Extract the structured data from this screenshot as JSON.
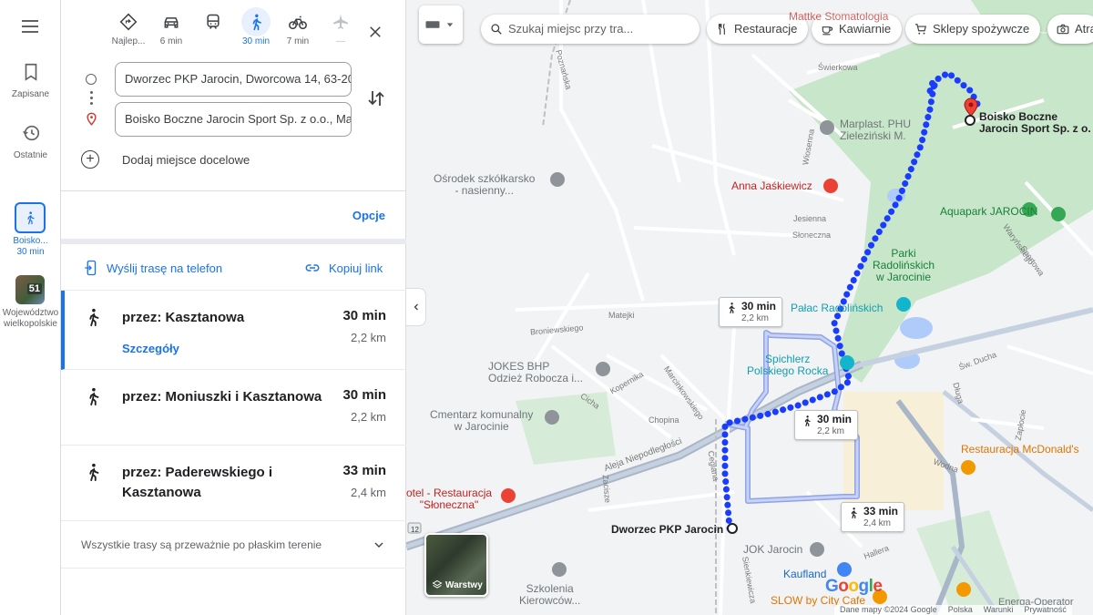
{
  "rail": {
    "saved_label": "Zapisane",
    "recent_label": "Ostatnie",
    "trip_label": "Boisko...",
    "trip_time": "30 min",
    "thumb_badge": "51",
    "thumb_label_1": "Województwo",
    "thumb_label_2": "wielkopolskie"
  },
  "modes": [
    {
      "name": "best",
      "label": "Najlep..."
    },
    {
      "name": "car",
      "label": "6 min"
    },
    {
      "name": "transit",
      "label": ""
    },
    {
      "name": "walk",
      "label": "30 min"
    },
    {
      "name": "bike",
      "label": "7 min"
    },
    {
      "name": "flight",
      "label": "—"
    }
  ],
  "waypoints": {
    "origin": "Dworzec PKP Jarocin, Dworcowa 14, 63-200",
    "destination": "Boisko Boczne Jarocin Sport Sp. z o.o., Ma",
    "add_label": "Dodaj miejsce docelowe"
  },
  "options_label": "Opcje",
  "share": {
    "send_label": "Wyślij trasę na telefon",
    "copy_label": "Kopiuj link"
  },
  "routes": [
    {
      "title": "przez: Kasztanowa",
      "time": "30 min",
      "distance": "2,2 km",
      "details": "Szczegóły"
    },
    {
      "title": "przez: Moniuszki i Kasztanowa",
      "time": "30 min",
      "distance": "2,2 km"
    },
    {
      "title": "przez: Paderewskiego i Kasztanowa",
      "time": "33 min",
      "distance": "2,4 km"
    }
  ],
  "flat_terrain_note": "Wszystkie trasy są przeważnie po płaskim terenie",
  "map": {
    "search_placeholder": "Szukaj miejsc przy tra...",
    "chips": [
      "Restauracje",
      "Kawiarnie",
      "Sklepy spożywcze",
      "Atra"
    ],
    "route_labels": [
      {
        "time": "30 min",
        "dist": "2,2 km"
      },
      {
        "time": "30 min",
        "dist": "2,2 km"
      },
      {
        "time": "33 min",
        "dist": "2,4 km"
      }
    ],
    "origin_label": "Dworzec PKP Jarocin",
    "destination_label_1": "Boisko Boczne",
    "destination_label_2": "Jarocin Sport Sp. z o.",
    "pois": {
      "marplast_1": "Marplast. PHU",
      "marplast_2": "Zieleziński M.",
      "anna": "Anna Jaśkiewicz",
      "osrodek_1": "Ośrodek szkółkarsko",
      "osrodek_2": "- nasienny...",
      "aquapark": "Aquapark JAROCIN",
      "parki_1": "Parki",
      "parki_2": "Radolińskich",
      "parki_3": "w Jarocinie",
      "palac": "Pałac Radolińskich",
      "spichlerz_1": "Spichlerz",
      "spichlerz_2": "Polskiego Rocka",
      "jokes_1": "JOKES BHP",
      "jokes_2": "Odzież Robocza i...",
      "cmentarz_1": "Cmentarz komunalny",
      "cmentarz_2": "w Jarocinie",
      "mcdonalds": "Restauracja McDonald's",
      "hotel_1": "otel - Restauracja",
      "hotel_2": "\"Słoneczna\"",
      "jok": "JOK Jarocin",
      "kaufland": "Kaufland",
      "szkolenia_1": "Szkolenia",
      "szkolenia_2": "Kierowców...",
      "slow": "SLOW by City Cafe",
      "energa": "Energa-Operator",
      "top_partial": "Mattke Stomatologia"
    },
    "streets": {
      "swierkowa": "Świerkowa",
      "wiosenna": "Wiosenna",
      "jesienna": "Jesienna",
      "sloneczna": "Słoneczna",
      "matejki": "Matejki",
      "broniewskiego": "Broniewskiego",
      "kopernika": "Kopernika",
      "marcinkowskiego": "Marcinkowskiego",
      "chopina": "Chopina",
      "cicha": "Cicha",
      "aleja": "Aleja Niepodległości",
      "ceglana": "Ceglana",
      "zacisze": "Zacisze",
      "poznanska": "Poznańska",
      "sw_ducha": "Św. Ducha",
      "dluga": "Długa",
      "wodna": "Wodna",
      "zaplocie": "Zapłocie",
      "hallera": "Hallera",
      "sportowa": "Sportowa",
      "warynskiego": "Waryńskiego",
      "sienkiewicza": "Sienkiewicza",
      "road_12": "12"
    },
    "layers_label": "Warstwy",
    "google": "Google",
    "footer": [
      "Dane mapy ©2024 Google",
      "Polska",
      "Warunki",
      "Prywatność"
    ]
  },
  "colors": {
    "accent": "#1a73e8",
    "route_main": "#1a3cff",
    "route_alt": "#9aa9e8",
    "park": "#c8e6c9"
  }
}
